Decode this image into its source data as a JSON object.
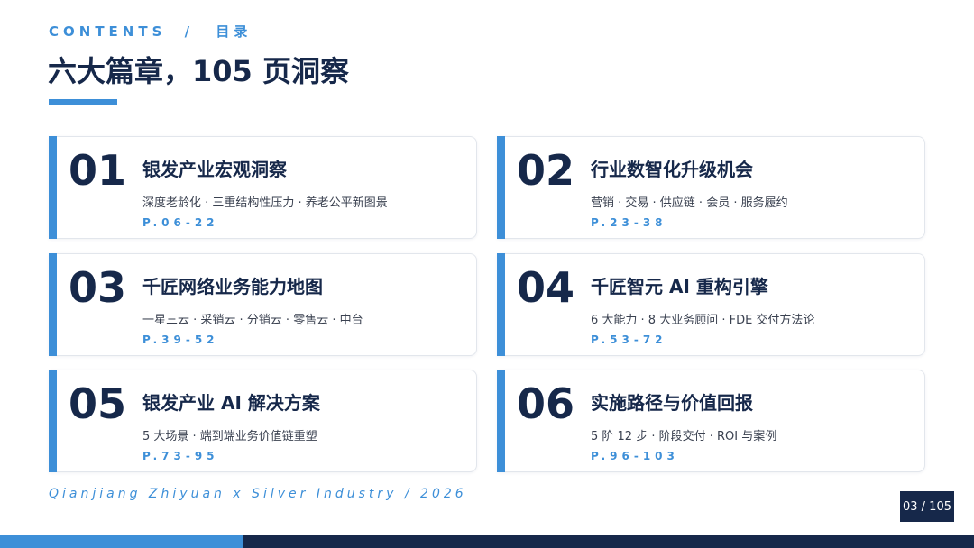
{
  "header": {
    "kicker_en": "CONTENTS",
    "kicker_sep": "/",
    "kicker_cn": "目录",
    "title": "六大篇章，105 页洞察"
  },
  "chapters": [
    {
      "num": "01",
      "title": "银发产业宏观洞察",
      "desc": "深度老龄化 · 三重结构性压力 · 养老公平新图景",
      "pages": "P.06-22"
    },
    {
      "num": "02",
      "title": "行业数智化升级机会",
      "desc": "营销 · 交易 · 供应链 · 会员 · 服务履约",
      "pages": "P.23-38"
    },
    {
      "num": "03",
      "title": "千匠网络业务能力地图",
      "desc": "一星三云 · 采销云 · 分销云 · 零售云 · 中台",
      "pages": "P.39-52"
    },
    {
      "num": "04",
      "title": "千匠智元 AI 重构引擎",
      "desc": "6 大能力 · 8 大业务顾问 · FDE 交付方法论",
      "pages": "P.53-72"
    },
    {
      "num": "05",
      "title": "银发产业 AI 解决方案",
      "desc": "5 大场景 · 端到端业务价值链重塑",
      "pages": "P.73-95"
    },
    {
      "num": "06",
      "title": "实施路径与价值回报",
      "desc": "5 阶 12 步 · 阶段交付 · ROI 与案例",
      "pages": "P.96-103"
    }
  ],
  "footer": {
    "tagline": "Qianjiang Zhiyuan x Silver Industry  /  2026",
    "page_indicator": "03 / 105"
  },
  "colors": {
    "accent": "#3d8fd8",
    "navy": "#16284a"
  }
}
